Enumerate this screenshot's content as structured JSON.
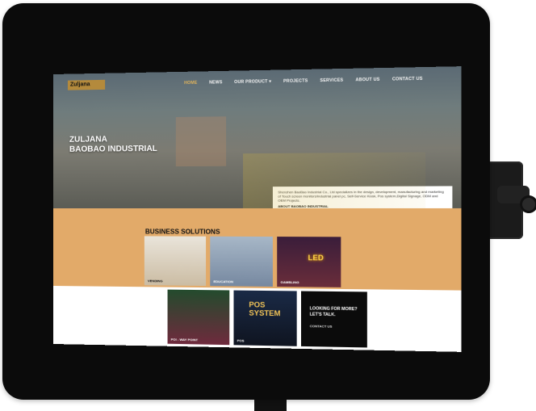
{
  "site": {
    "logo": "Zuljana",
    "nav": [
      "HOME",
      "NEWS",
      "OUR PRODUCT ▾",
      "PROJECTS",
      "SERVICES",
      "ABOUT US",
      "CONTACT US"
    ],
    "hero": {
      "title_line1": "ZULJANA",
      "title_line2": "BAOBAO INDUSTRIAL",
      "info_text": "Shenzhen BaoBao Industrial Co., Ltd specializes in the design, development, manufacturing and marketing of Touch screen monitors/industrial panel pc, Self-Service Kiosk, Pos system,Digital Signage, ODM and OEM Projects.",
      "info_link": "ABOUT BAOBAO INDUSTRIAL"
    },
    "business": {
      "title": "BUSINESS SOLUTIONS",
      "tiles": [
        {
          "label": "VENDING"
        },
        {
          "label": "EDUCATION"
        },
        {
          "label": "GAMBLING"
        },
        {
          "label": "POI - WAY POINT"
        },
        {
          "label": "POS",
          "overlay": "POS SYSTEM"
        },
        {
          "label": "LOOKING FOR MORE? LET'S TALK.",
          "cta": "CONTACT US"
        }
      ],
      "led_text": "LED"
    }
  }
}
